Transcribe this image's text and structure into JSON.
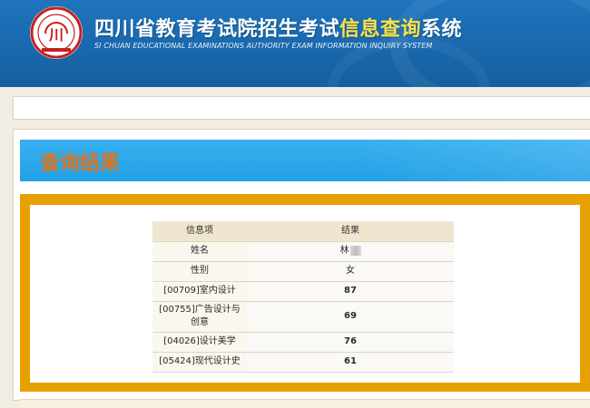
{
  "header": {
    "title_prefix": "四川省教育考试院招生考试",
    "title_highlight": "信息查询",
    "title_suffix": "系统",
    "subtitle": "SI CHUAN EDUCATIONAL EXAMINATIONS AUTHORITY EXAM INFORMATION INQUIRY SYSTEM",
    "logo_icon": "authority-seal-icon",
    "logo_text": "川"
  },
  "colors": {
    "header_blue": "#1968ad",
    "banner_blue": "#22a0e6",
    "result_title_orange": "#e0731a",
    "frame_gold": "#e6a100",
    "title_highlight": "#ffe14a"
  },
  "result": {
    "title": "查询结果",
    "columns": {
      "item": "信息项",
      "result": "结果"
    },
    "name": {
      "label": "姓名",
      "value": "林"
    },
    "gender": {
      "label": "性别",
      "value": "女"
    },
    "scores": [
      {
        "label": "[00709]室内设计",
        "value": "87"
      },
      {
        "label": "[00755]广告设计与创意",
        "value": "69"
      },
      {
        "label": "[04026]设计美学",
        "value": "76"
      },
      {
        "label": "[05424]现代设计史",
        "value": "61"
      }
    ]
  }
}
